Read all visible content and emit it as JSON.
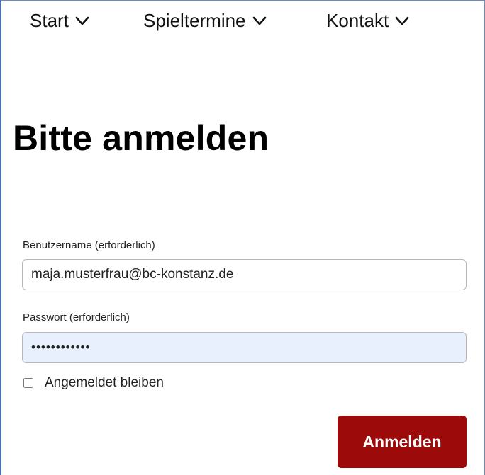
{
  "nav": {
    "items": [
      {
        "label": "Start",
        "icon": "chevron-down-icon"
      },
      {
        "label": "Spieltermine",
        "icon": "chevron-down-icon"
      },
      {
        "label": "Kontakt",
        "icon": "chevron-down-icon"
      }
    ]
  },
  "page": {
    "title": "Bitte anmelden"
  },
  "form": {
    "username_label": "Benutzername (erforderlich)",
    "username_value": "maja.musterfrau@bc-konstanz.de",
    "password_label": "Passwort (erforderlich)",
    "password_masked": "••••••••••••",
    "remember_label": "Angemeldet bleiben",
    "remember_checked": false,
    "submit_label": "Anmelden"
  },
  "colors": {
    "accent": "#9c0a0a",
    "autofill_background": "#e8f0fe",
    "frame_border": "#4a6fa5"
  }
}
